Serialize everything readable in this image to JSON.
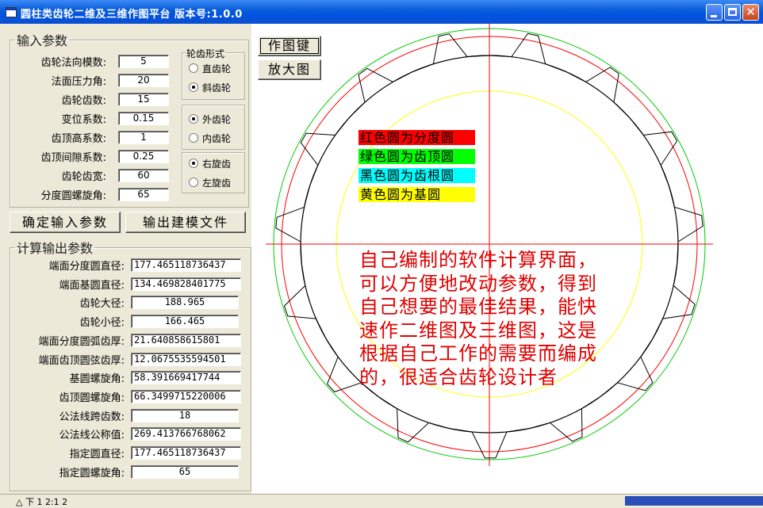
{
  "window": {
    "title": "圆柱类齿轮二维及三维作图平台 版本号:1.0.0"
  },
  "input_group": {
    "title": "输入参数",
    "fields": [
      {
        "label": "齿轮法向模数:",
        "value": "5"
      },
      {
        "label": "法面压力角:",
        "value": "20"
      },
      {
        "label": "齿轮齿数:",
        "value": "15"
      },
      {
        "label": "变位系数:",
        "value": "0.15"
      },
      {
        "label": "齿顶高系数:",
        "value": "1"
      },
      {
        "label": "齿顶间隙系数:",
        "value": "0.25"
      },
      {
        "label": "齿轮齿宽:",
        "value": "60"
      },
      {
        "label": "分度圆螺旋角:",
        "value": "65"
      }
    ],
    "tooth_form": {
      "title": "轮齿形式",
      "options": [
        {
          "label": "直齿轮",
          "selected": false
        },
        {
          "label": "斜齿轮",
          "selected": true
        }
      ]
    },
    "gear_type": {
      "options": [
        {
          "label": "外齿轮",
          "selected": true
        },
        {
          "label": "内齿轮",
          "selected": false
        }
      ]
    },
    "helix_dir": {
      "options": [
        {
          "label": "右旋齿",
          "selected": true
        },
        {
          "label": "左旋齿",
          "selected": false
        }
      ]
    }
  },
  "buttons": {
    "confirm": "确定输入参数",
    "export": "输出建模文件",
    "draw": "作图键",
    "zoom": "放大图"
  },
  "output_group": {
    "title": "计算输出参数",
    "fields": [
      {
        "label": "端面分度圆直径:",
        "value": "177.465118736437"
      },
      {
        "label": "端面基圆直径:",
        "value": "134.469828401775"
      },
      {
        "label": "齿轮大径:",
        "value": "188.965"
      },
      {
        "label": "齿轮小径:",
        "value": "166.465"
      },
      {
        "label": "端面分度圆弧齿厚:",
        "value": "21.640858615801"
      },
      {
        "label": "端面齿顶圆弦齿厚:",
        "value": "12.0675535594501"
      },
      {
        "label": "基圆螺旋角:",
        "value": "58.391669417744"
      },
      {
        "label": "齿顶圆螺旋角:",
        "value": "66.3499715220006"
      },
      {
        "label": "公法线跨齿数:",
        "value": "18"
      },
      {
        "label": "公法线公称值:",
        "value": "269.413766768062"
      },
      {
        "label": "指定圆直径:",
        "value": "177.465118736437"
      },
      {
        "label": "指定圆螺旋角:",
        "value": "65"
      }
    ]
  },
  "drawing": {
    "legend": [
      {
        "text": "红色圆为分度圆",
        "bg": "#ff0000",
        "fg": "#000000"
      },
      {
        "text": "绿色圆为齿顶圆",
        "bg": "#00ff00",
        "fg": "#000000"
      },
      {
        "text": "黑色圆为齿根圆",
        "bg": "#00ffff",
        "fg": "#000000"
      },
      {
        "text": "黄色圆为基圆",
        "bg": "#ffff00",
        "fg": "#000000"
      }
    ],
    "note": "自己编制的软件计算界面，可以方便地改动参数，得到自己想要的最佳结果，能快速作二维图及三维图，这是根据自己工作的需要而编成的，很适合齿轮设计者",
    "colors": {
      "pitch_circle": "#ff0000",
      "tip_circle": "#00cc00",
      "root_circle": "#000000",
      "base_circle": "#ffff00",
      "axes": "#ff0000",
      "note_text": "#e00000"
    },
    "teeth": 15
  },
  "status": {
    "text": "△ 下 1 2:1 2"
  }
}
